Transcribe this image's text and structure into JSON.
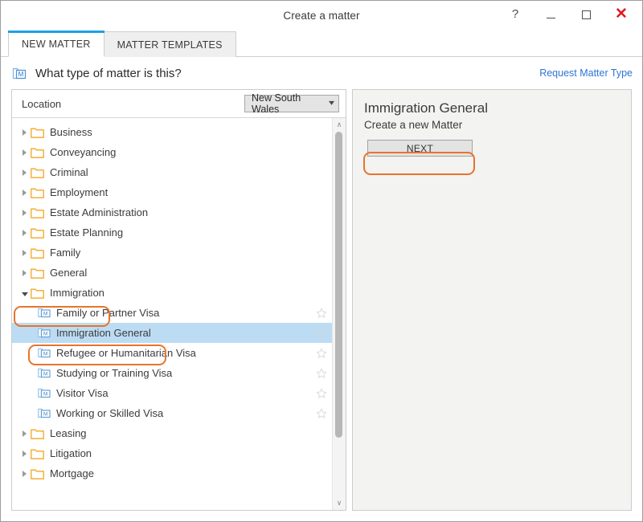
{
  "window": {
    "title": "Create a matter",
    "controls": {
      "help": "?",
      "minimize": "—",
      "maximize": "□",
      "close": "✕"
    }
  },
  "tabs": [
    {
      "label": "NEW MATTER",
      "active": true
    },
    {
      "label": "MATTER TEMPLATES",
      "active": false
    }
  ],
  "header": {
    "title": "What type of matter is this?",
    "link": "Request Matter Type",
    "icon": "matter-type-icon"
  },
  "location": {
    "label": "Location",
    "selected": "New South Wales"
  },
  "tree": [
    {
      "label": "Business",
      "type": "folder",
      "expanded": false,
      "selected": false,
      "star": false
    },
    {
      "label": "Conveyancing",
      "type": "folder",
      "expanded": false,
      "selected": false,
      "star": false
    },
    {
      "label": "Criminal",
      "type": "folder",
      "expanded": false,
      "selected": false,
      "star": false
    },
    {
      "label": "Employment",
      "type": "folder",
      "expanded": false,
      "selected": false,
      "star": false
    },
    {
      "label": "Estate Administration",
      "type": "folder",
      "expanded": false,
      "selected": false,
      "star": false
    },
    {
      "label": "Estate Planning",
      "type": "folder",
      "expanded": false,
      "selected": false,
      "star": false
    },
    {
      "label": "Family",
      "type": "folder",
      "expanded": false,
      "selected": false,
      "star": false
    },
    {
      "label": "General",
      "type": "folder",
      "expanded": false,
      "selected": false,
      "star": false
    },
    {
      "label": "Immigration",
      "type": "folder",
      "expanded": true,
      "selected": false,
      "star": false
    },
    {
      "label": "Family or Partner Visa",
      "type": "matter",
      "child": true,
      "selected": false,
      "star": true
    },
    {
      "label": "Immigration General",
      "type": "matter",
      "child": true,
      "selected": true,
      "star": true
    },
    {
      "label": "Refugee or Humanitarian Visa",
      "type": "matter",
      "child": true,
      "selected": false,
      "star": true
    },
    {
      "label": "Studying or Training Visa",
      "type": "matter",
      "child": true,
      "selected": false,
      "star": true
    },
    {
      "label": "Visitor Visa",
      "type": "matter",
      "child": true,
      "selected": false,
      "star": true
    },
    {
      "label": "Working or Skilled Visa",
      "type": "matter",
      "child": true,
      "selected": false,
      "star": true
    },
    {
      "label": "Leasing",
      "type": "folder",
      "expanded": false,
      "selected": false,
      "star": false
    },
    {
      "label": "Litigation",
      "type": "folder",
      "expanded": false,
      "selected": false,
      "star": false
    },
    {
      "label": "Mortgage",
      "type": "folder",
      "expanded": false,
      "selected": false,
      "star": false
    }
  ],
  "scrollbar": {
    "up_glyph": "∧",
    "down_glyph": "∨",
    "thumb_top_pct": 0,
    "thumb_height_pct": 84
  },
  "detail": {
    "title": "Immigration General",
    "subtitle": "Create a new Matter",
    "next_label": "NEXT"
  },
  "colors": {
    "tab_accent": "#1ba1e2",
    "link": "#2e75d4",
    "highlight_outline": "#e8742c",
    "selection": "#bcdcf4",
    "folder": "#f5a623",
    "matter_icon": "#5b9bd5",
    "close": "#e01b24"
  }
}
